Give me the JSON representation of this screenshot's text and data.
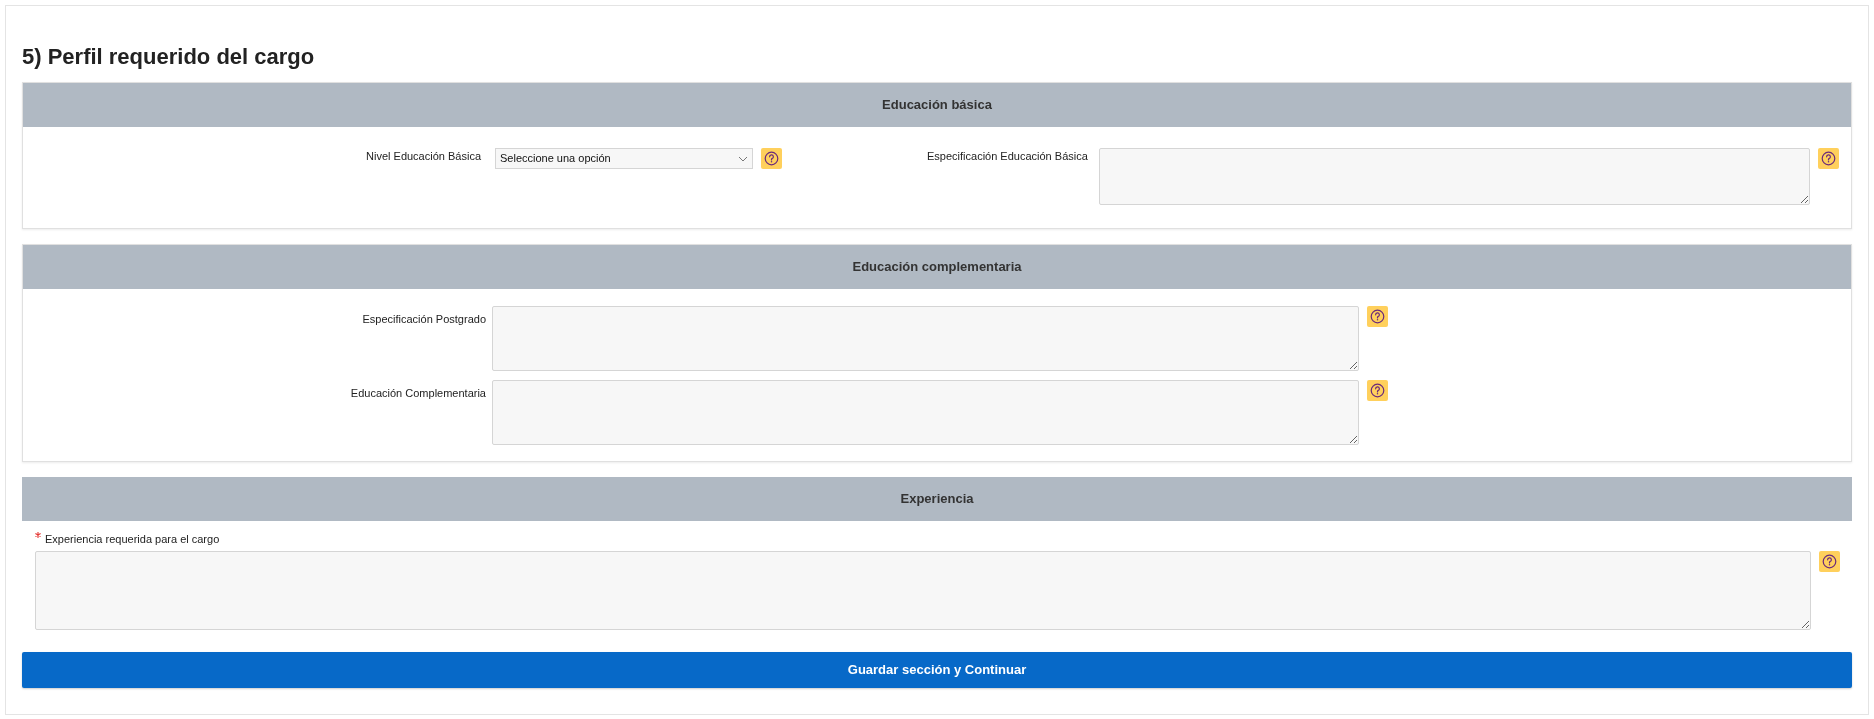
{
  "title": "5) Perfil requerido del cargo",
  "sections": [
    {
      "heading": "Educación básica",
      "kind": "inline",
      "fields": [
        {
          "kind": "select",
          "label": "Nivel Educación Básica",
          "value": "Seleccione una opción",
          "required": false
        },
        {
          "kind": "textarea",
          "label": "Especificación Educación Básica",
          "required": false
        }
      ]
    },
    {
      "heading": "Educación complementaria",
      "kind": "rows",
      "fields": [
        {
          "kind": "textarea",
          "label": "Especificación Postgrado",
          "required": false
        },
        {
          "kind": "textarea",
          "label": "Educación Complementaria",
          "required": false
        }
      ]
    },
    {
      "heading": "Experiencia",
      "kind": "stacked",
      "fields": [
        {
          "kind": "textarea",
          "label": "Experiencia requerida para el cargo",
          "required": true
        }
      ]
    }
  ],
  "submit": "Guardar sección y Continuar"
}
